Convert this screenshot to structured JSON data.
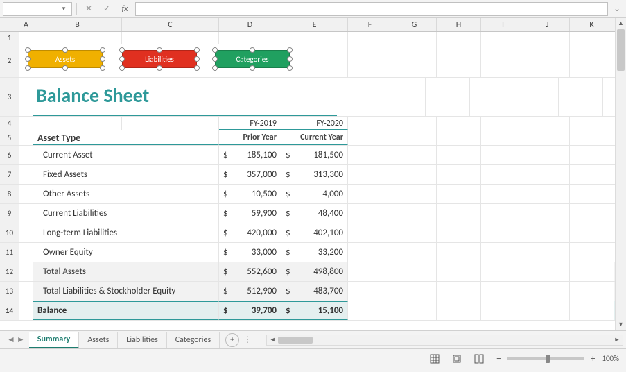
{
  "formula_bar": {
    "name_box": "",
    "cancel_glyph": "✕",
    "confirm_glyph": "✓",
    "fx_glyph": "fx",
    "expand_glyph": "⌄"
  },
  "columns": [
    "A",
    "B",
    "C",
    "D",
    "E",
    "F",
    "G",
    "H",
    "I",
    "J",
    "K"
  ],
  "rows_visible": 14,
  "shapes": [
    {
      "label": "Assets",
      "color": "assets"
    },
    {
      "label": "Liabilities",
      "color": "liab"
    },
    {
      "label": "Categories",
      "color": "cats"
    }
  ],
  "title": "Balance Sheet",
  "years": {
    "prior_header": "FY-2019",
    "current_header": "FY-2020",
    "prior_label": "Prior Year",
    "current_label": "Current Year"
  },
  "asset_type_label": "Asset Type",
  "data_rows": [
    {
      "label": "Current Asset",
      "prior": "185,100",
      "current": "181,500"
    },
    {
      "label": "Fixed Assets",
      "prior": "357,000",
      "current": "313,300"
    },
    {
      "label": "Other Assets",
      "prior": "10,500",
      "current": "4,000"
    },
    {
      "label": "Current Liabilities",
      "prior": "59,900",
      "current": "48,400"
    },
    {
      "label": "Long-term Liabilities",
      "prior": "420,000",
      "current": "402,100"
    },
    {
      "label": "Owner Equity",
      "prior": "33,000",
      "current": "33,200"
    }
  ],
  "totals": [
    {
      "label": "Total Assets",
      "prior": "552,600",
      "current": "498,800"
    },
    {
      "label": "Total Liabilities & Stockholder Equity",
      "prior": "512,900",
      "current": "483,700"
    }
  ],
  "balance": {
    "label": "Balance",
    "prior": "39,700",
    "current": "15,100"
  },
  "currency": "$",
  "tabs": [
    "Summary",
    "Assets",
    "Liabilities",
    "Categories"
  ],
  "active_tab": "Summary",
  "add_sheet_glyph": "+",
  "zoom_label": "100%",
  "nav": {
    "left": "◄",
    "right": "►"
  },
  "scroll": {
    "up": "▲",
    "down": "▼",
    "left": "◄",
    "right": "►"
  }
}
